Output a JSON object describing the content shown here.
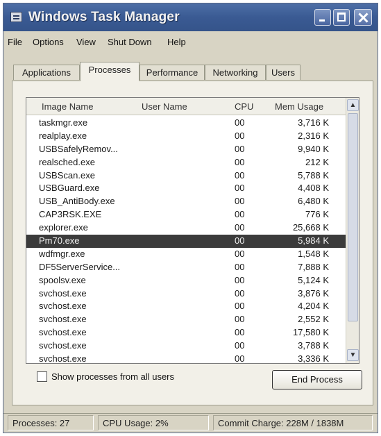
{
  "window": {
    "title": "Windows Task Manager"
  },
  "menu": [
    "File",
    "Options",
    "View",
    "Shut Down",
    "Help"
  ],
  "tabs": [
    "Applications",
    "Processes",
    "Performance",
    "Networking",
    "Users"
  ],
  "active_tab": "Processes",
  "columns": {
    "image_name": "Image Name",
    "user_name": "User Name",
    "cpu": "CPU",
    "mem": "Mem Usage"
  },
  "processes": [
    {
      "name": "taskmgr.exe",
      "cpu": "00",
      "mem": "3,716 K"
    },
    {
      "name": "realplay.exe",
      "cpu": "00",
      "mem": "2,316 K"
    },
    {
      "name": "USBSafelyRemov...",
      "cpu": "00",
      "mem": "9,940 K"
    },
    {
      "name": "realsched.exe",
      "cpu": "00",
      "mem": "212 K"
    },
    {
      "name": "USBScan.exe",
      "cpu": "00",
      "mem": "5,788 K"
    },
    {
      "name": "USBGuard.exe",
      "cpu": "00",
      "mem": "4,408 K"
    },
    {
      "name": "USB_AntiBody.exe",
      "cpu": "00",
      "mem": "6,480 K"
    },
    {
      "name": "CAP3RSK.EXE",
      "cpu": "00",
      "mem": "776 K"
    },
    {
      "name": "explorer.exe",
      "cpu": "00",
      "mem": "25,668 K"
    },
    {
      "name": "Pm70.exe",
      "cpu": "00",
      "mem": "5,984 K"
    },
    {
      "name": "wdfmgr.exe",
      "cpu": "00",
      "mem": "1,548 K"
    },
    {
      "name": "DF5ServerService...",
      "cpu": "00",
      "mem": "7,888 K"
    },
    {
      "name": "spoolsv.exe",
      "cpu": "00",
      "mem": "5,124 K"
    },
    {
      "name": "svchost.exe",
      "cpu": "00",
      "mem": "3,876 K"
    },
    {
      "name": "svchost.exe",
      "cpu": "00",
      "mem": "4,204 K"
    },
    {
      "name": "svchost.exe",
      "cpu": "00",
      "mem": "2,552 K"
    },
    {
      "name": "svchost.exe",
      "cpu": "00",
      "mem": "17,580 K"
    },
    {
      "name": "svchost.exe",
      "cpu": "00",
      "mem": "3,788 K"
    },
    {
      "name": "svchost.exe",
      "cpu": "00",
      "mem": "3,336 K"
    }
  ],
  "selected_process": "Pm70.exe",
  "show_all_users_label": "Show processes from all users",
  "end_process_label": "End Process",
  "status": {
    "processes": "Processes: 27",
    "cpu": "CPU Usage: 2%",
    "commit": "Commit Charge: 228M / 1838M"
  },
  "colors": {
    "titlebar": "#3a5a93",
    "selection": "#3b3b3b",
    "window_bg": "#d8d4c4"
  }
}
